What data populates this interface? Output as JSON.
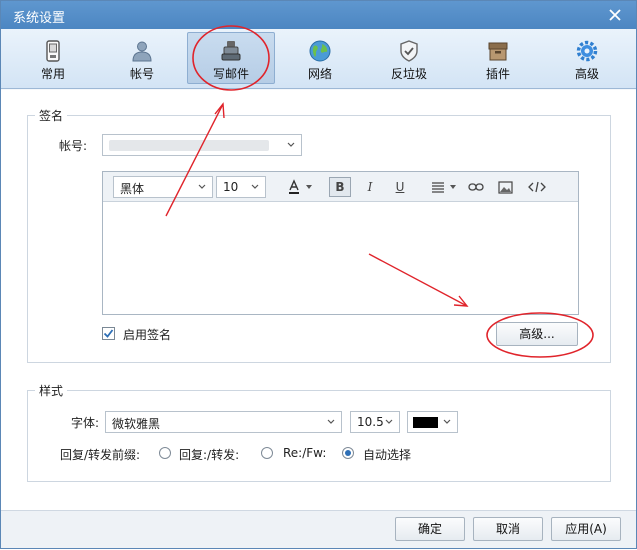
{
  "window": {
    "title": "系统设置"
  },
  "toolbar": {
    "items": [
      {
        "label": "常用",
        "icon": "phone-icon",
        "active": false
      },
      {
        "label": "帐号",
        "icon": "user-icon",
        "active": false
      },
      {
        "label": "写邮件",
        "icon": "compose-mail-icon",
        "active": true
      },
      {
        "label": "网络",
        "icon": "globe-icon",
        "active": false
      },
      {
        "label": "反垃圾",
        "icon": "shield-icon",
        "active": false
      },
      {
        "label": "插件",
        "icon": "plugin-box-icon",
        "active": false
      },
      {
        "label": "高级",
        "icon": "gear-icon",
        "active": false
      }
    ]
  },
  "signature": {
    "group_title": "签名",
    "account_label": "帐号:",
    "account_value": "",
    "editor": {
      "font": "黑体",
      "size": "10",
      "content": ""
    },
    "enable_label": "启用签名",
    "enable_checked": true,
    "advanced_button": "高级..."
  },
  "style": {
    "group_title": "样式",
    "font_label": "字体:",
    "font_value": "微软雅黑",
    "size_value": "10.5",
    "color_value": "#000000",
    "prefix_label": "回复/转发前缀:",
    "options": [
      "回复:/转发:",
      "Re:/Fw:",
      "自动选择"
    ],
    "selected_index": 2
  },
  "footer": {
    "ok": "确定",
    "cancel": "取消",
    "apply": "应用(A)"
  },
  "colors": {
    "titlebar": "#4c86c2",
    "annotation": "#e0242b",
    "accent": "#2e6fb6"
  }
}
